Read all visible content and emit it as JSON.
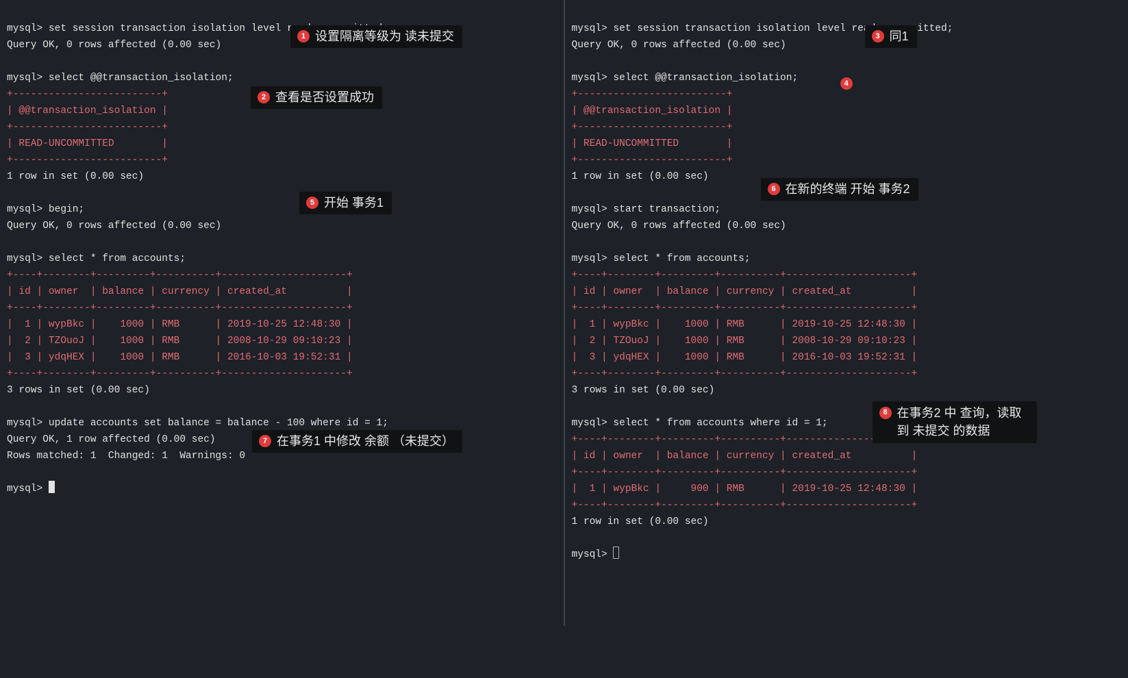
{
  "prompt": "mysql> ",
  "left": {
    "l1": "set session transaction isolation level read uncommitted;",
    "l2": "Query OK, 0 rows affected (0.00 sec)",
    "l3": "select @@transaction_isolation;",
    "iso_border": "+-------------------------+",
    "iso_header": "| @@transaction_isolation |",
    "iso_value": "| READ-UNCOMMITTED        |",
    "iso_footer": "1 row in set (0.00 sec)",
    "l4": "begin;",
    "l5": "Query OK, 0 rows affected (0.00 sec)",
    "l6": "select * from accounts;",
    "tbl_border": "+----+--------+---------+----------+---------------------+",
    "tbl_header": "| id | owner  | balance | currency | created_at          |",
    "row1": "|  1 | wypBkc |    1000 | RMB      | 2019-10-25 12:48:30 |",
    "row2": "|  2 | TZOuoJ |    1000 | RMB      | 2008-10-29 09:10:23 |",
    "row3": "|  3 | ydqHEX |    1000 | RMB      | 2016-10-03 19:52:31 |",
    "tbl_footer": "3 rows in set (0.00 sec)",
    "l7": "update accounts set balance = balance - 100 where id = 1;",
    "l8": "Query OK, 1 row affected (0.00 sec)",
    "l9": "Rows matched: 1  Changed: 1  Warnings: 0"
  },
  "right": {
    "l1": "set session transaction isolation level read uncommitted;",
    "l2": "Query OK, 0 rows affected (0.00 sec)",
    "l3": "select @@transaction_isolation;",
    "iso_border": "+-------------------------+",
    "iso_header": "| @@transaction_isolation |",
    "iso_value": "| READ-UNCOMMITTED        |",
    "iso_footer": "1 row in set (0.00 sec)",
    "l4": "start transaction;",
    "l5": "Query OK, 0 rows affected (0.00 sec)",
    "l6": "select * from accounts;",
    "tbl_border": "+----+--------+---------+----------+---------------------+",
    "tbl_header": "| id | owner  | balance | currency | created_at          |",
    "row1": "|  1 | wypBkc |    1000 | RMB      | 2019-10-25 12:48:30 |",
    "row2": "|  2 | TZOuoJ |    1000 | RMB      | 2008-10-29 09:10:23 |",
    "row3": "|  3 | ydqHEX |    1000 | RMB      | 2016-10-03 19:52:31 |",
    "tbl_footer": "3 rows in set (0.00 sec)",
    "l7": "select * from accounts where id = 1;",
    "tbl2_border": "+----+--------+---------+----------+---------------------+",
    "tbl2_header": "| id | owner  | balance | currency | created_at          |",
    "tbl2_row1": "|  1 | wypBkc |     900 | RMB      | 2019-10-25 12:48:30 |",
    "tbl2_footer": "1 row in set (0.00 sec)"
  },
  "notes": {
    "n1": {
      "num": "1",
      "text": "设置隔离等级为 读未提交"
    },
    "n2": {
      "num": "2",
      "text": "查看是否设置成功"
    },
    "n3": {
      "num": "3",
      "text": "同1"
    },
    "n4": {
      "num": "4"
    },
    "n5": {
      "num": "5",
      "text": "开始 事务1"
    },
    "n6": {
      "num": "6",
      "text": "在新的终端 开始 事务2"
    },
    "n7": {
      "num": "7",
      "text": "在事务1 中修改 余额 （未提交）"
    },
    "n8": {
      "num": "8",
      "text": "在事务2 中 查询，读取到 未提交 的数据"
    }
  }
}
